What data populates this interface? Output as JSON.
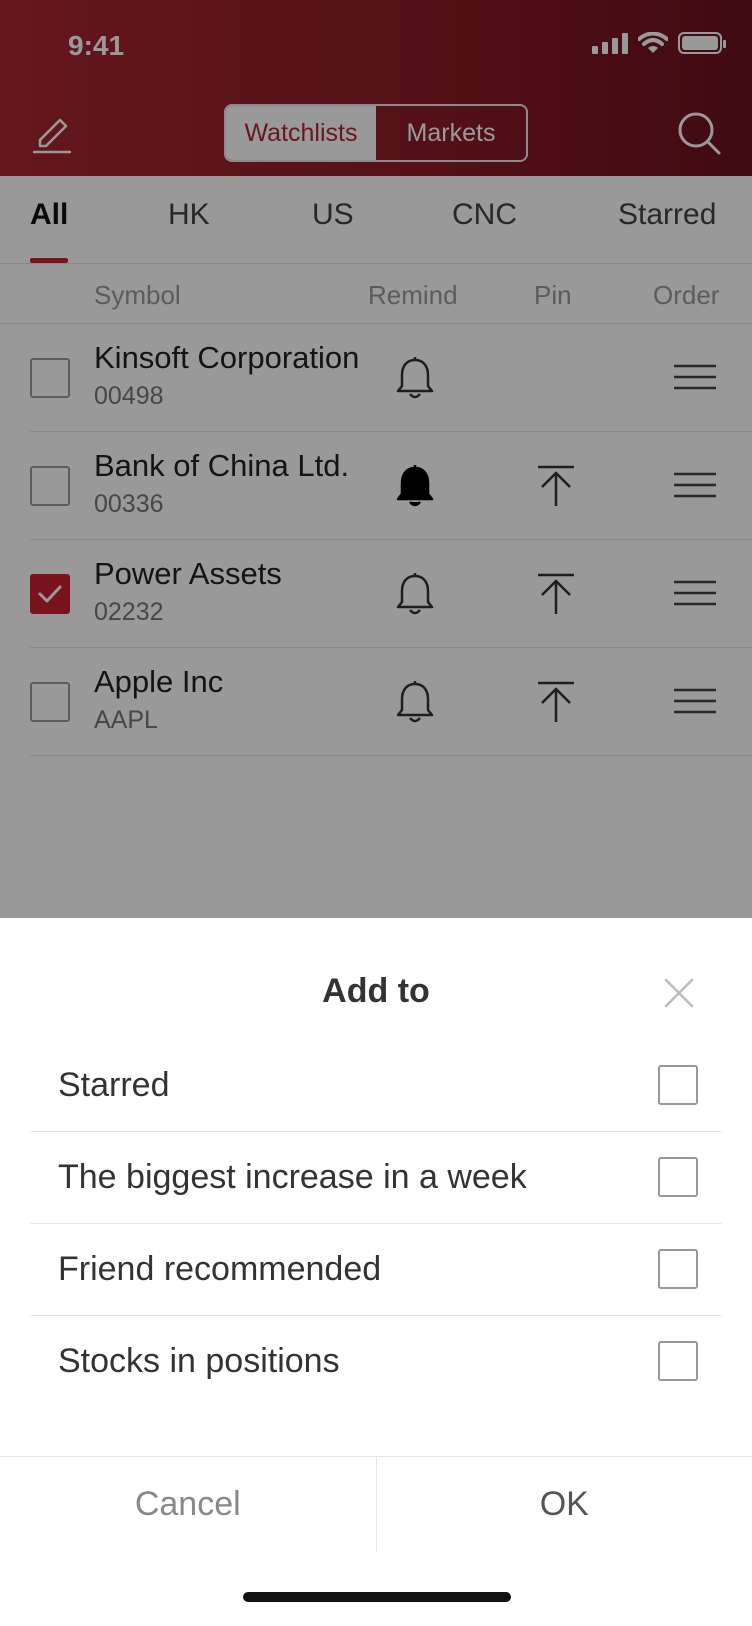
{
  "status_bar": {
    "time": "9:41"
  },
  "header": {
    "segments": [
      {
        "label": "Watchlists",
        "active": true
      },
      {
        "label": "Markets",
        "active": false
      }
    ]
  },
  "tabs": [
    "All",
    "HK",
    "US",
    "CNC",
    "Starred"
  ],
  "active_tab": "All",
  "columns": {
    "symbol": "Symbol",
    "remind": "Remind",
    "pin": "Pin",
    "order": "Order"
  },
  "stocks": [
    {
      "name": "Kinsoft Corporation",
      "code": "00498",
      "checked": false,
      "remind_active": false,
      "pinned_icon": false
    },
    {
      "name": "Bank of China Ltd.",
      "code": "00336",
      "checked": false,
      "remind_active": true,
      "pinned_icon": true
    },
    {
      "name": "Power Assets",
      "code": "02232",
      "checked": true,
      "remind_active": false,
      "pinned_icon": true
    },
    {
      "name": "Apple Inc",
      "code": "AAPL",
      "checked": false,
      "remind_active": false,
      "pinned_icon": true
    }
  ],
  "sheet": {
    "title": "Add to",
    "options": [
      {
        "label": "Starred",
        "checked": false
      },
      {
        "label": "The biggest increase in a week",
        "checked": false
      },
      {
        "label": "Friend recommended",
        "checked": false
      },
      {
        "label": "Stocks in positions",
        "checked": false
      }
    ],
    "cancel_label": "Cancel",
    "ok_label": "OK"
  },
  "colors": {
    "brand": "#b32533",
    "accent": "#c8202f"
  }
}
